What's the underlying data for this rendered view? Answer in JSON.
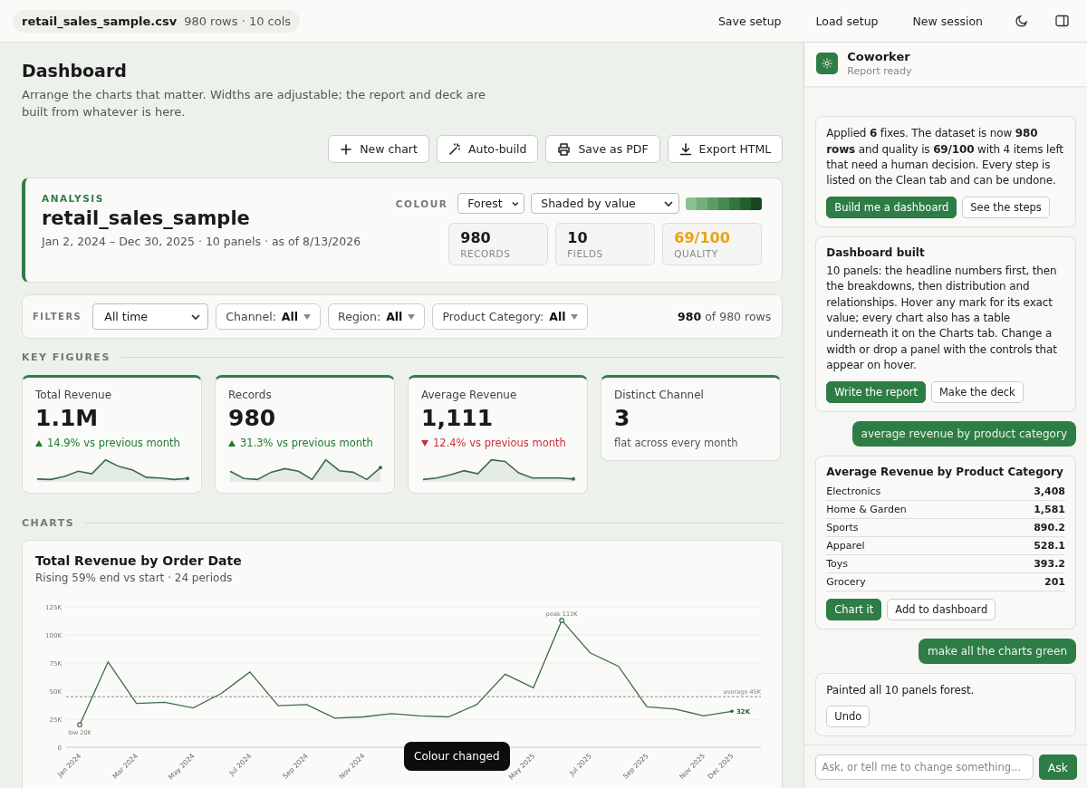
{
  "topbar": {
    "file_name": "retail_sales_sample.csv",
    "file_meta": "980 rows · 10 cols",
    "actions": [
      "Save setup",
      "Load setup",
      "New session"
    ]
  },
  "page": {
    "title": "Dashboard",
    "subtitle": "Arrange the charts that matter. Widths are adjustable; the report and deck are built from whatever is here.",
    "toolbar": [
      "New chart",
      "Auto-build",
      "Save as PDF",
      "Export HTML"
    ]
  },
  "analysis": {
    "eyebrow": "ANALYSIS",
    "title": "retail_sales_sample",
    "meta": "Jan 2, 2024 – Dec 30, 2025 · 10 panels · as of 8/13/2026",
    "colour_label": "COLOUR",
    "palette": "Forest",
    "mode": "Shaded by value",
    "stats": [
      {
        "value": "980",
        "label": "RECORDS",
        "warning": false
      },
      {
        "value": "10",
        "label": "FIELDS",
        "warning": false
      },
      {
        "value": "69/100",
        "label": "QUALITY",
        "warning": true
      }
    ]
  },
  "filters": {
    "label": "FILTERS",
    "period": "All time",
    "chips": [
      {
        "name": "Channel:",
        "value": "All"
      },
      {
        "name": "Region:",
        "value": "All"
      },
      {
        "name": "Product Category:",
        "value": "All"
      }
    ],
    "count": "**980** of 980 rows"
  },
  "key_figures": {
    "heading": "KEY FIGURES",
    "cards": [
      {
        "kind": "up",
        "label": "Total Revenue",
        "value": "1.1M",
        "change": "14.9% vs previous month",
        "sparkline": true
      },
      {
        "kind": "up",
        "label": "Records",
        "value": "980",
        "change": "31.3% vs previous month",
        "sparkline": true
      },
      {
        "kind": "down",
        "label": "Average Revenue",
        "value": "1,111",
        "change": "12.4% vs previous month",
        "sparkline": true
      },
      {
        "kind": "flat",
        "label": "Distinct Channel",
        "value": "3",
        "change": "flat across every month",
        "sparkline": false
      }
    ]
  },
  "charts": {
    "heading": "CHARTS",
    "panels": [
      {
        "title": "Total Revenue by Order Date",
        "subtitle": "Rising 59% end vs start · 24 periods",
        "chart_data": {
          "type": "line",
          "categories": [
            "Jan 2024",
            null,
            "Mar 2024",
            null,
            "May 2024",
            null,
            "Jul 2024",
            null,
            "Sep 2024",
            null,
            "Nov 2024",
            null,
            null,
            null,
            null,
            null,
            "May 2025",
            null,
            "Jul 2025",
            null,
            "Sep 2025",
            null,
            "Nov 2025",
            "Dec 2025"
          ],
          "series": [
            {
              "color": "#3d6b4a",
              "values": [
                20,
                76,
                39,
                40,
                35,
                48,
                67,
                37,
                38,
                26,
                27,
                30,
                28,
                27,
                38,
                65,
                53,
                113,
                84,
                72,
                36,
                34,
                28,
                32
              ]
            }
          ],
          "ylim": [
            0,
            125
          ],
          "yticks": [
            {
              "value": 0,
              "label": "0"
            },
            {
              "value": 25,
              "label": "25K"
            },
            {
              "value": 50,
              "label": "50K"
            },
            {
              "value": 75,
              "label": "75K"
            },
            {
              "value": 100,
              "label": "100K"
            },
            {
              "value": 125,
              "label": "125K"
            }
          ],
          "grid": true,
          "ref_lines": [
            {
              "axis": "y",
              "value": 45,
              "label": "average 45K"
            }
          ],
          "annotations": [
            {
              "text": "low 20K",
              "x": "Jan 2024",
              "y": 20
            },
            {
              "text": "peak 113K",
              "y": 113
            },
            {
              "text": "32K",
              "x": "Dec 2025",
              "y": 32
            }
          ]
        }
      }
    ]
  },
  "toast": "Colour changed",
  "assistant": {
    "name": "Coworker",
    "status": "Report ready",
    "input_placeholder": "Ask, or tell me to change something...",
    "send": "Ask",
    "messages": [
      {
        "kind": "assistant",
        "text": "Applied **6** fixes. The dataset is now **980 rows** and quality is **69/100** with 4 items left that need a human decision. Every step is listed on the Clean tab and can be undone.",
        "actions": [
          {
            "label": "Build me a dashboard",
            "primary": true
          },
          {
            "label": "See the steps",
            "primary": false
          }
        ]
      },
      {
        "kind": "assistant",
        "title": "Dashboard built",
        "text": "10 panels: the headline numbers first, then the breakdowns, then distribution and relationships. Hover any mark for its exact value; every chart also has a table underneath it on the Charts tab. Change a width or drop a panel with the controls that appear on hover.",
        "actions": [
          {
            "label": "Write the report",
            "primary": true
          },
          {
            "label": "Make the deck",
            "primary": false
          }
        ]
      },
      {
        "kind": "user",
        "text": "average revenue by product category"
      },
      {
        "kind": "assistant",
        "title": "Average Revenue by Product Category",
        "table": [
          {
            "name": "Electronics",
            "value": "3,408"
          },
          {
            "name": "Home & Garden",
            "value": "1,581"
          },
          {
            "name": "Sports",
            "value": "890.2"
          },
          {
            "name": "Apparel",
            "value": "528.1"
          },
          {
            "name": "Toys",
            "value": "393.2"
          },
          {
            "name": "Grocery",
            "value": "201"
          }
        ],
        "actions": [
          {
            "label": "Chart it",
            "primary": true
          },
          {
            "label": "Add to dashboard",
            "primary": false
          }
        ]
      },
      {
        "kind": "user",
        "text": "make all the charts green"
      },
      {
        "kind": "assistant",
        "text": "Painted all 10 panels forest.",
        "actions": [
          {
            "label": "Undo",
            "primary": false
          }
        ]
      }
    ]
  }
}
